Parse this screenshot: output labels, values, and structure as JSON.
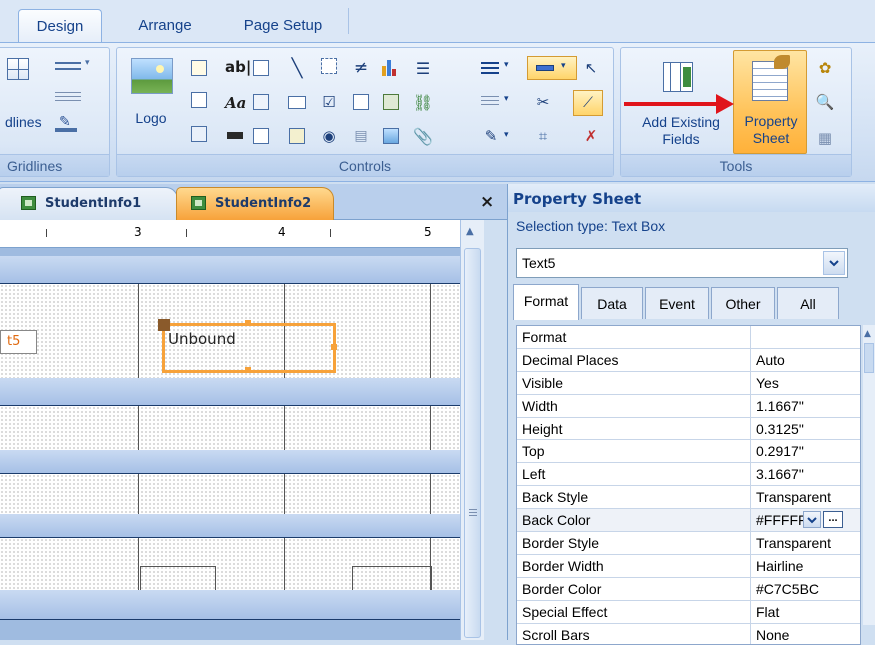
{
  "ribbon_tabs": [
    {
      "label": "Design",
      "active": true
    },
    {
      "label": "Arrange",
      "active": false
    },
    {
      "label": "Page Setup",
      "active": false
    }
  ],
  "gridlines_group": {
    "label": "Gridlines",
    "button_label": "Gridlines"
  },
  "controls_group": {
    "label": "Controls",
    "logo_label": "Logo",
    "text_control_label": "ab|"
  },
  "tools_group": {
    "label": "Tools",
    "add_existing_fields": "Add Existing Fields",
    "property_sheet": "Property Sheet"
  },
  "doc_tabs": [
    {
      "label": "StudentInfo1",
      "active": false
    },
    {
      "label": "StudentInfo2",
      "active": true
    }
  ],
  "close_glyph": "×",
  "ruler_marks": [
    "3",
    "4",
    "5"
  ],
  "design": {
    "textbox_label": "Unbound",
    "label_fragment": "t5"
  },
  "property_sheet": {
    "title": "Property Sheet",
    "selection_type": "Selection type:  Text Box",
    "selected_object": "Text5",
    "tabs": [
      {
        "label": "Format",
        "active": true
      },
      {
        "label": "Data",
        "active": false
      },
      {
        "label": "Event",
        "active": false
      },
      {
        "label": "Other",
        "active": false
      },
      {
        "label": "All",
        "active": false
      }
    ],
    "rows": [
      {
        "name": "Format",
        "value": ""
      },
      {
        "name": "Decimal Places",
        "value": "Auto"
      },
      {
        "name": "Visible",
        "value": "Yes"
      },
      {
        "name": "Width",
        "value": "1.1667\""
      },
      {
        "name": "Height",
        "value": "0.3125\""
      },
      {
        "name": "Top",
        "value": "0.2917\""
      },
      {
        "name": "Left",
        "value": "3.1667\""
      },
      {
        "name": "Back Style",
        "value": "Transparent"
      },
      {
        "name": "Back Color",
        "value": "#FFFFF"
      },
      {
        "name": "Border Style",
        "value": "Transparent"
      },
      {
        "name": "Border Width",
        "value": "Hairline"
      },
      {
        "name": "Border Color",
        "value": "#C7C5BC"
      },
      {
        "name": "Special Effect",
        "value": "Flat"
      },
      {
        "name": "Scroll Bars",
        "value": "None"
      }
    ]
  },
  "colors": {
    "accent_orange": "#f7a23a",
    "arrow_red": "#e0141b",
    "ribbon_blue": "#15428b"
  }
}
